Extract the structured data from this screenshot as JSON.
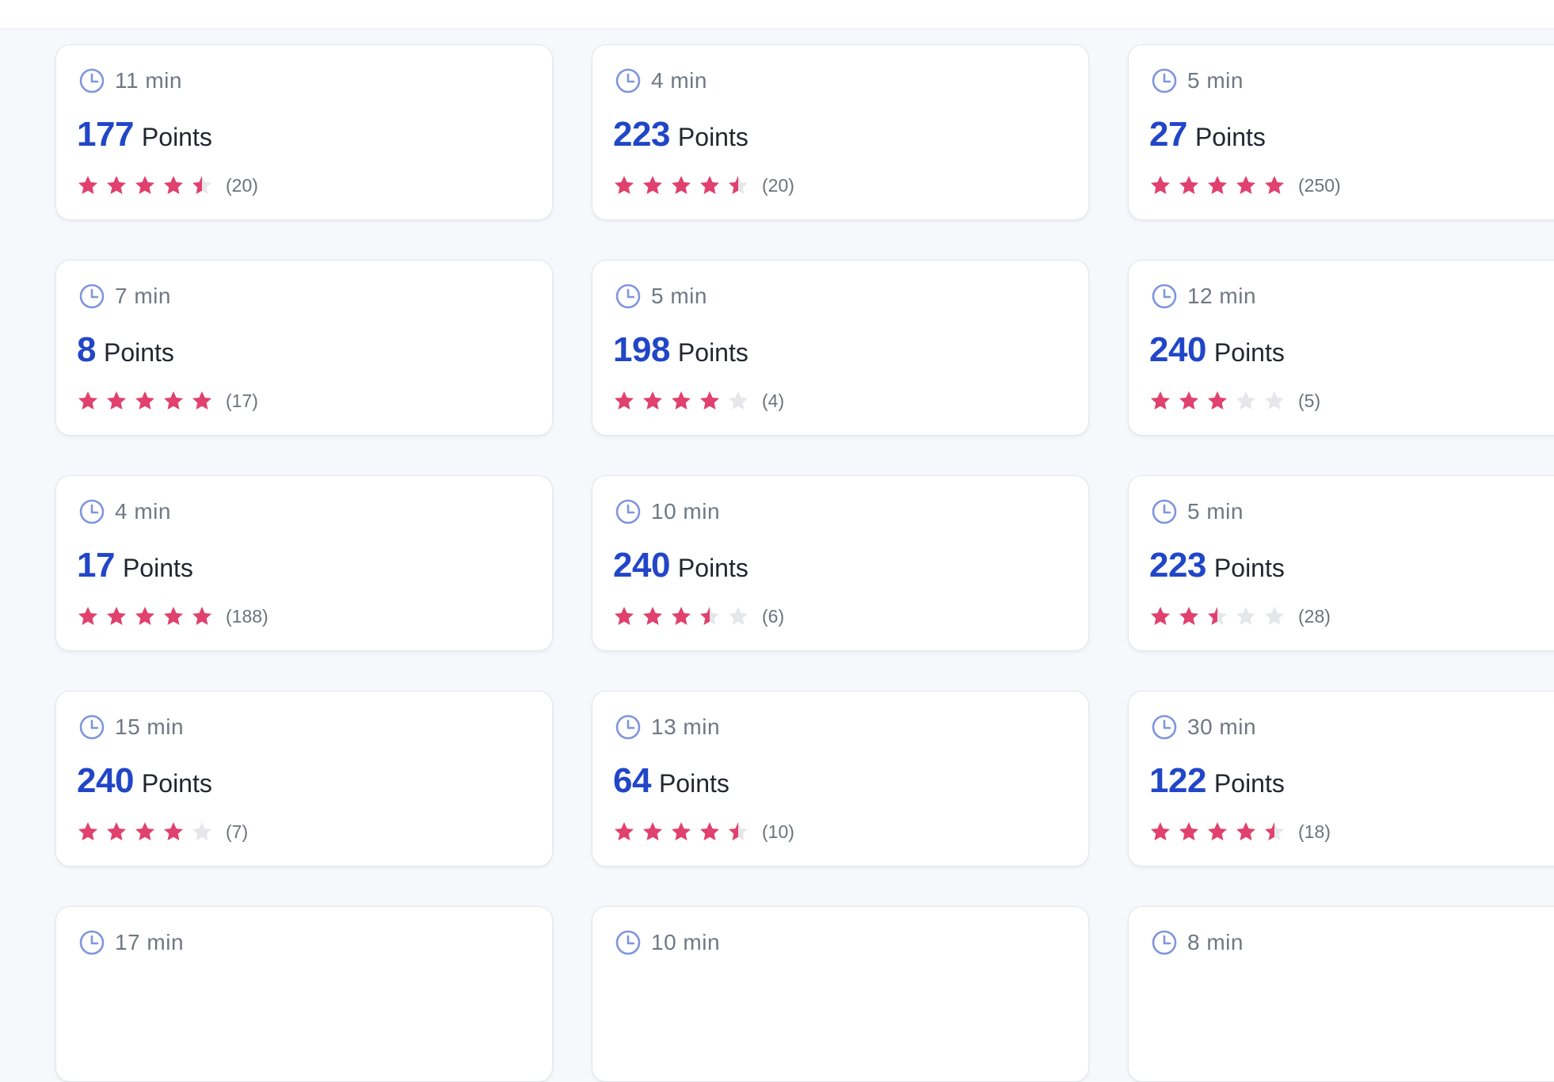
{
  "cards": [
    {
      "time": "11 min",
      "points": "177",
      "points_label": "Points",
      "rating": 4.5,
      "count": "(20)"
    },
    {
      "time": "4 min",
      "points": "223",
      "points_label": "Points",
      "rating": 4.5,
      "count": "(20)"
    },
    {
      "time": "5 min",
      "points": "27",
      "points_label": "Points",
      "rating": 5,
      "count": "(250)"
    },
    {
      "time": "7 min",
      "points": "8",
      "points_label": "Points",
      "rating": 5,
      "count": "(17)"
    },
    {
      "time": "5 min",
      "points": "198",
      "points_label": "Points",
      "rating": 4,
      "count": "(4)"
    },
    {
      "time": "12 min",
      "points": "240",
      "points_label": "Points",
      "rating": 3,
      "count": "(5)"
    },
    {
      "time": "4 min",
      "points": "17",
      "points_label": "Points",
      "rating": 5,
      "count": "(188)"
    },
    {
      "time": "10 min",
      "points": "240",
      "points_label": "Points",
      "rating": 3.5,
      "count": "(6)"
    },
    {
      "time": "5 min",
      "points": "223",
      "points_label": "Points",
      "rating": 2.5,
      "count": "(28)"
    },
    {
      "time": "15 min",
      "points": "240",
      "points_label": "Points",
      "rating": 4,
      "count": "(7)"
    },
    {
      "time": "13 min",
      "points": "64",
      "points_label": "Points",
      "rating": 4.5,
      "count": "(10)"
    },
    {
      "time": "30 min",
      "points": "122",
      "points_label": "Points",
      "rating": 4.5,
      "count": "(18)"
    },
    {
      "time": "17 min"
    },
    {
      "time": "10 min"
    },
    {
      "time": "8 min"
    }
  ],
  "colors": {
    "accent": "#2146c7",
    "star_filled": "#e0416e",
    "star_empty": "#e6e7ea",
    "clock": "#7f96dc"
  },
  "icons": {
    "time": "clock-icon",
    "rating": "star-icon"
  }
}
